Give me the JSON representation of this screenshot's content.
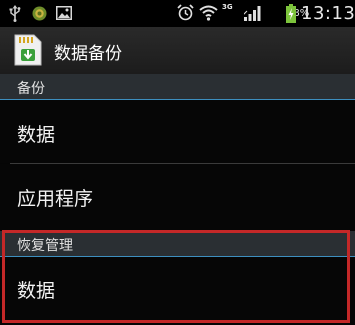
{
  "status_bar": {
    "icons": [
      "usb-icon",
      "android-debug-icon",
      "gallery-icon",
      "alarm-icon",
      "wifi-icon",
      "signal-icon",
      "battery-charging-icon"
    ],
    "network_type": "3G",
    "battery_percent": "88%",
    "time": "13:13"
  },
  "action_bar": {
    "icon": "sd-card-backup-icon",
    "title": "数据备份"
  },
  "sections": [
    {
      "header": "备份",
      "items": [
        {
          "label": "数据"
        },
        {
          "label": "应用程序"
        }
      ]
    },
    {
      "header": "恢复管理",
      "items": [
        {
          "label": "数据"
        }
      ]
    }
  ],
  "colors": {
    "section_header_bg": "#2a2f33",
    "accent": "#3d8fbf",
    "highlight": "#c42828",
    "battery": "#7dc43c"
  }
}
